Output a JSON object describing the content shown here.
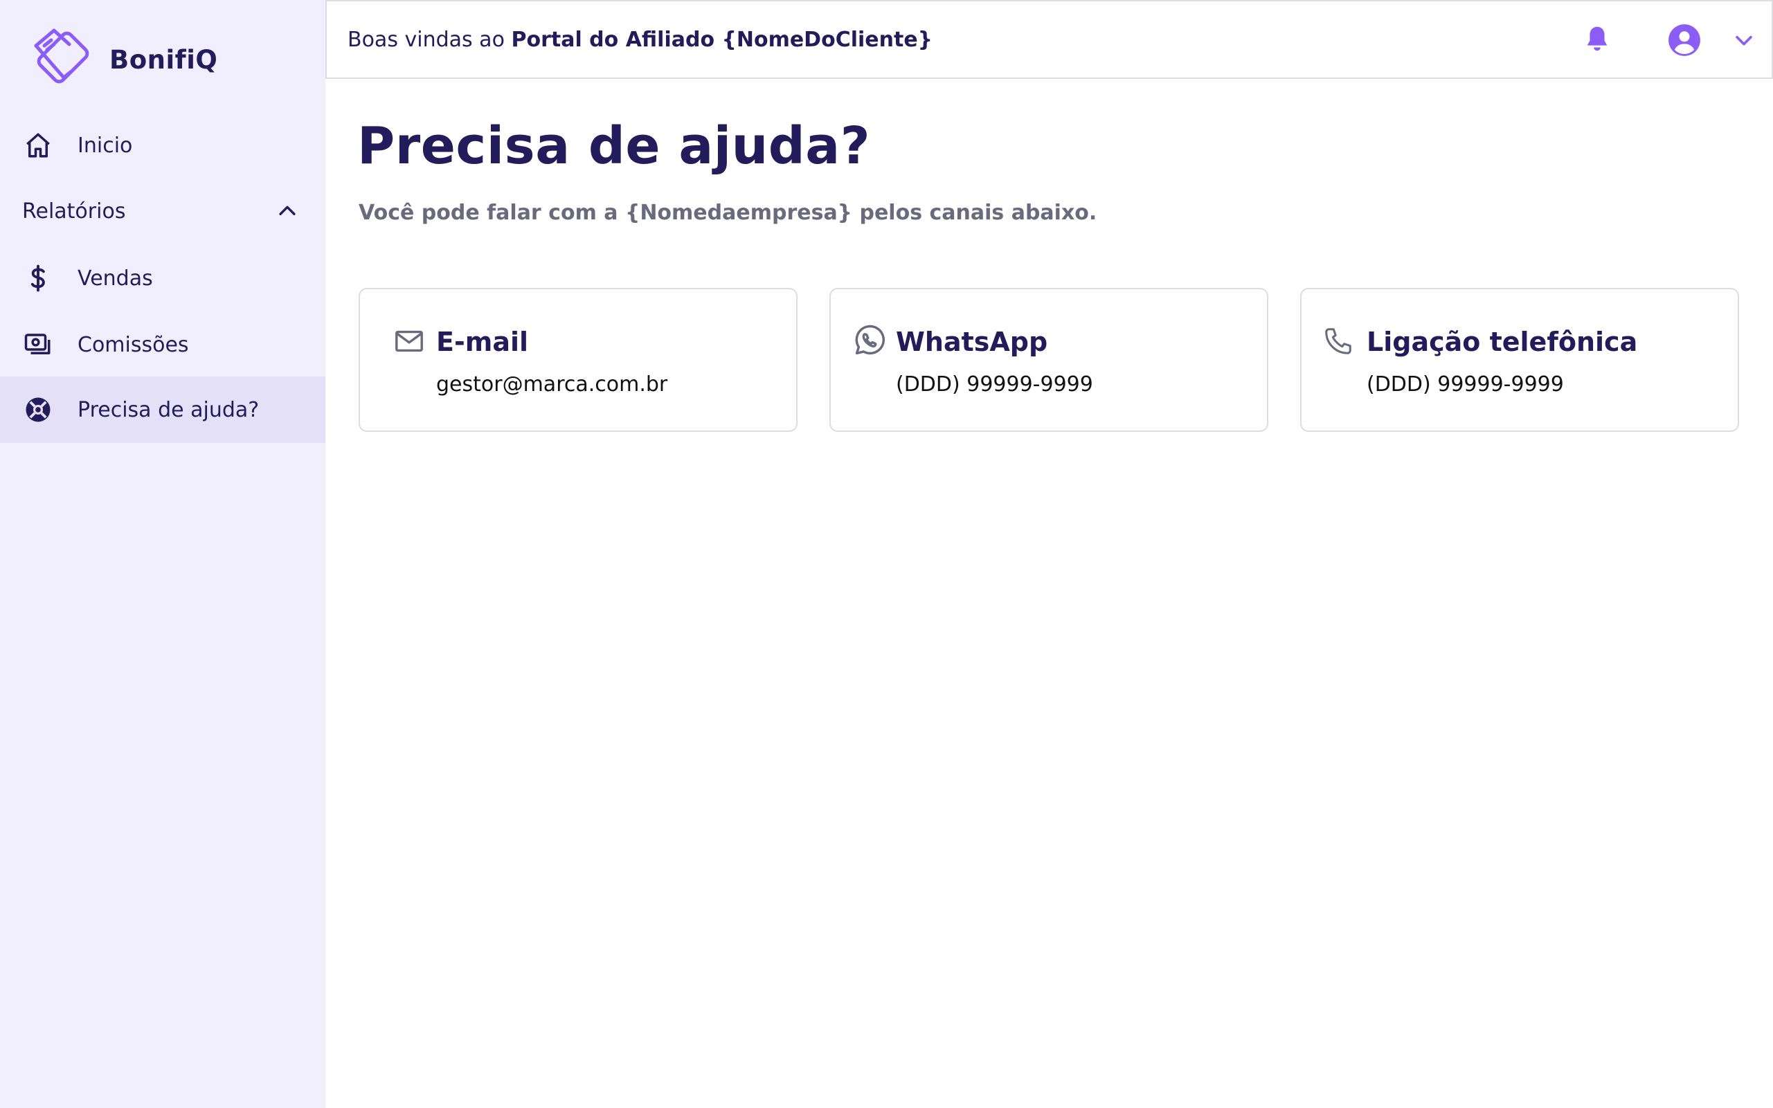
{
  "brand": {
    "name": "BonifiQ",
    "accent": "#8b5cf6",
    "navy": "#231c5a"
  },
  "header": {
    "welcome_prefix": "Boas vindas ao",
    "welcome_bold": "Portal do Afiliado {NomeDoCliente}",
    "icons": [
      "bell-icon",
      "user-circle-icon",
      "chevron-down-icon"
    ]
  },
  "sidebar": {
    "items": [
      {
        "label": "Inicio",
        "icon": "home-icon"
      },
      {
        "label": "Vendas",
        "icon": "dollar-icon"
      },
      {
        "label": "Comissões",
        "icon": "cash-icon"
      },
      {
        "label": "Precisa de ajuda?",
        "icon": "lifebuoy-icon",
        "active": true
      }
    ],
    "section": {
      "label": "Relatórios",
      "expanded": true,
      "icon": "chevron-up-icon"
    }
  },
  "main": {
    "title": "Precisa de ajuda?",
    "subtitle": "Você pode falar com a {Nomedaempresa} pelos canais abaixo.",
    "cards": [
      {
        "title": "E-mail",
        "value": "gestor@marca.com.br",
        "icon": "mail-icon"
      },
      {
        "title": "WhatsApp",
        "value": "(DDD) 99999-9999",
        "icon": "whatsapp-icon"
      },
      {
        "title": "Ligação telefônica",
        "value": "(DDD) 99999-9999",
        "icon": "phone-icon"
      }
    ]
  }
}
